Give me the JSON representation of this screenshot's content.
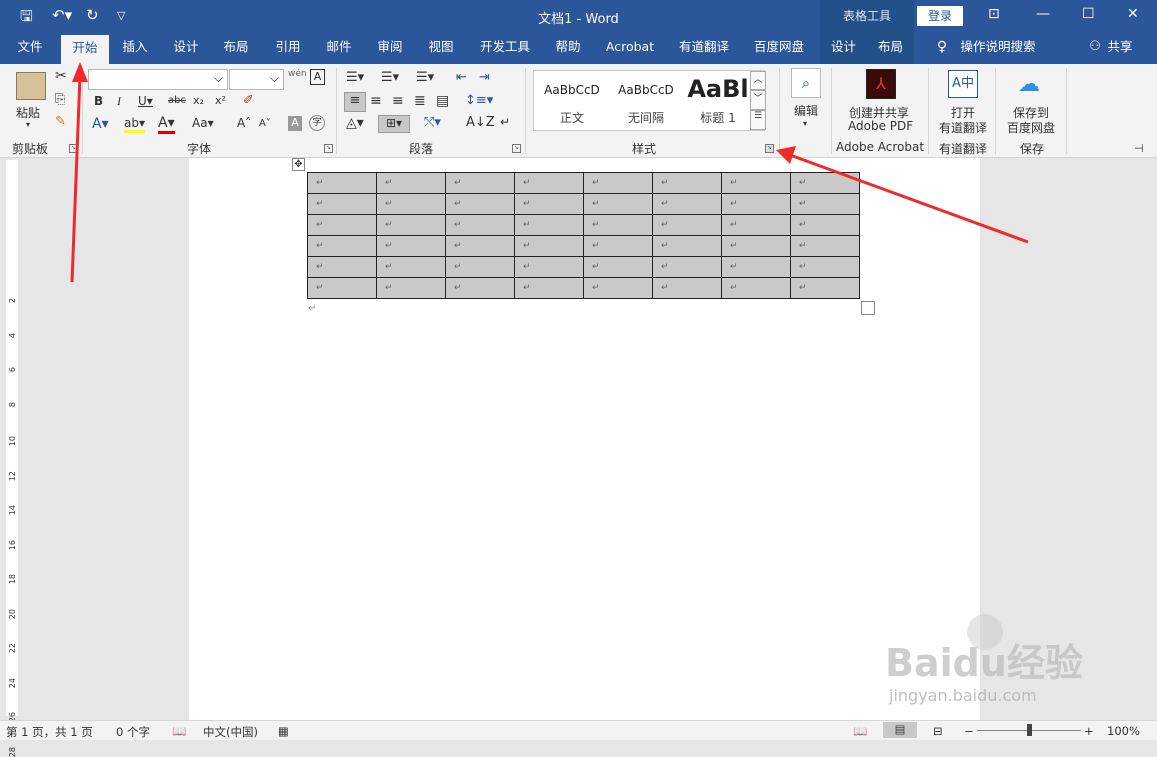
{
  "title": "文档1  -  Word",
  "context_tab_group": "表格工具",
  "login_label": "登录",
  "share_label": "共享",
  "tell_me": "操作说明搜索",
  "tabs": [
    "文件",
    "开始",
    "插入",
    "设计",
    "布局",
    "引用",
    "邮件",
    "审阅",
    "视图",
    "开发工具",
    "帮助",
    "Acrobat",
    "有道翻译",
    "百度网盘",
    "设计",
    "布局"
  ],
  "active_tab": "开始",
  "ribbon": {
    "clipboard": {
      "label": "剪贴板",
      "paste": "粘贴"
    },
    "font": {
      "label": "字体",
      "font_name": "",
      "font_size": ""
    },
    "paragraph": {
      "label": "段落"
    },
    "styles": {
      "label": "样式",
      "items": [
        {
          "preview": "AaBbCcD",
          "name": "正文"
        },
        {
          "preview": "AaBbCcD",
          "name": "无间隔"
        },
        {
          "preview": "AaBl",
          "name": "标题 1"
        }
      ]
    },
    "editing": {
      "label": "编辑"
    },
    "acrobat": {
      "button": "创建并共享",
      "button2": "Adobe PDF",
      "label": "Adobe Acrobat"
    },
    "youdao": {
      "button": "打开",
      "button2": "有道翻译",
      "label": "有道翻译"
    },
    "save": {
      "button": "保存到",
      "button2": "百度网盘",
      "label": "保存"
    }
  },
  "ruler_numbers": [
    "2",
    "4",
    "6",
    "8",
    "10",
    "12",
    "14",
    "16",
    "18",
    "20",
    "22",
    "24",
    "26",
    "28"
  ],
  "table": {
    "rows": 6,
    "cols": 8,
    "cell_mark": "↵"
  },
  "paragraph_mark": "↵",
  "status": {
    "page": "第 1 页，共 1 页",
    "words": "0 个字",
    "language": "中文(中国)",
    "zoom": "100%"
  },
  "watermark": {
    "brand": "Baidu经验",
    "url": "jingyan.baidu.com"
  },
  "colors": {
    "accent": "#2b579a",
    "arrow": "#ee2a2a",
    "table_fill": "#c9c9c9"
  }
}
